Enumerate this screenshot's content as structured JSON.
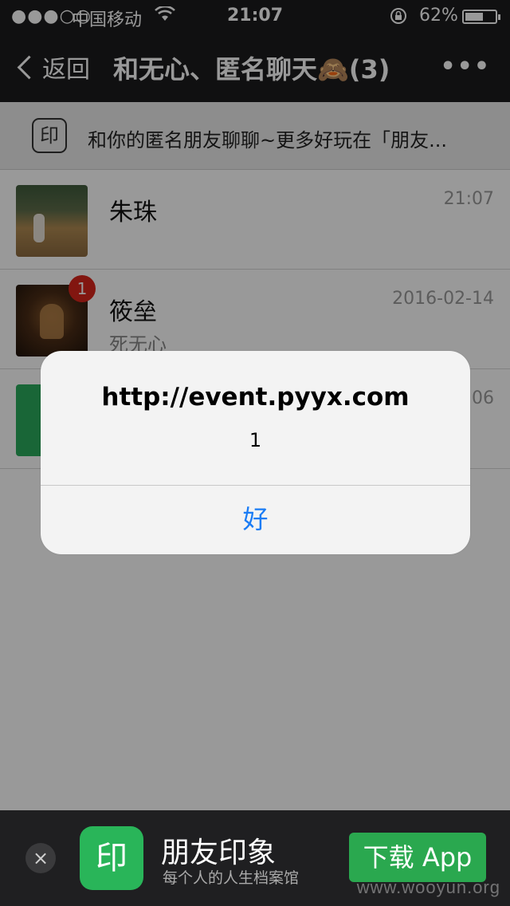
{
  "status_bar": {
    "signal": "●●●○○",
    "carrier": "中国移动",
    "wifi": "wifi-icon",
    "time": "21:07",
    "battery_percent": "62%",
    "battery_level": 0.62
  },
  "nav": {
    "back_label": "返回",
    "title": "和无心、匿名聊天🙈(3)",
    "more_label": "•••"
  },
  "banner": {
    "stamp": "印",
    "text": "和你的匿名朋友聊聊~更多好玩在「朋友..."
  },
  "chats": [
    {
      "name": "朱珠",
      "preview": "",
      "time": "21:07",
      "badge": ""
    },
    {
      "name": "筱垒",
      "preview": "死无心",
      "time": "2016-02-14",
      "badge": "1"
    },
    {
      "name": "",
      "preview": "",
      "time": "06",
      "badge": ""
    }
  ],
  "alert": {
    "title": "http://event.pyyx.com",
    "message": "1",
    "ok_label": "好"
  },
  "app_bar": {
    "close": "×",
    "logo": "印",
    "name": "朋友印象",
    "subtitle": "每个人的人生档案馆",
    "download_label": "下载 App"
  },
  "watermark": "www.wooyun.org",
  "colors": {
    "bar_bg": "#1b1b1d",
    "alert_button": "#1a7cf5",
    "badge": "#d9261c",
    "brand_green": "#29b559"
  }
}
